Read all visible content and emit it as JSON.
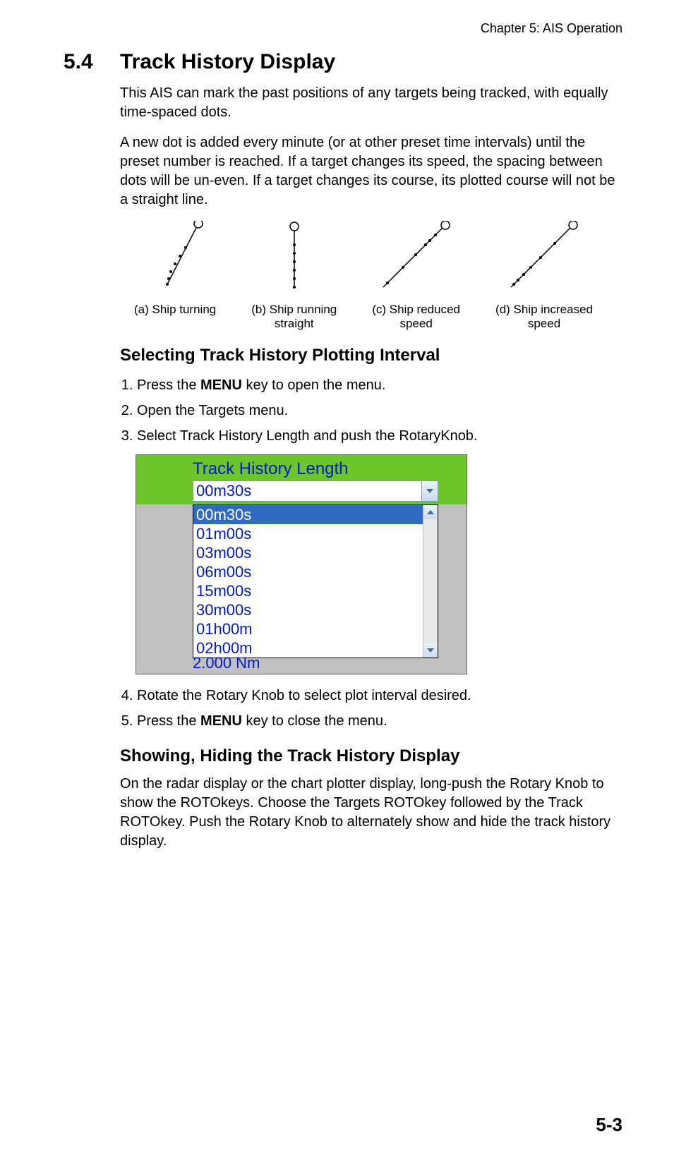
{
  "chapter_header": "Chapter 5: AIS Operation",
  "section": {
    "number": "5.4",
    "title": "Track History Display"
  },
  "paras": {
    "intro1": "This AIS can mark the past positions of any targets being tracked, with equally time-spaced dots.",
    "intro2": "A new dot is added every minute (or at other preset time intervals) until the preset number is reached. If a target changes its speed, the spacing between dots will be un-even. If a target changes its course, its plotted course will not be a straight line."
  },
  "diagrams": {
    "a": {
      "label": "(a) Ship turning"
    },
    "b": {
      "label1": "(b) Ship running",
      "label2": "straight"
    },
    "c": {
      "label1": "(c) Ship reduced",
      "label2": "speed"
    },
    "d": {
      "label1": "(d) Ship increased",
      "label2": "speed"
    }
  },
  "sub1": {
    "heading": "Selecting Track History Plotting Interval",
    "s1a": "Press the ",
    "s1b": "MENU",
    "s1c": " key to open the menu.",
    "s2": "Open the Targets menu.",
    "s3": "Select Track History Length and push the RotaryKnob.",
    "s4": "Rotate the Rotary Knob to select plot interval desired.",
    "s5a": "Press the ",
    "s5b": "MENU",
    "s5c": " key to close the menu."
  },
  "widget": {
    "title": "Track History Length",
    "selected_display": "00m30s",
    "options": [
      "00m30s",
      "01m00s",
      "03m00s",
      "06m00s",
      "15m00s",
      "30m00s",
      "01h00m",
      "02h00m"
    ],
    "ghost": "2.000 Nm"
  },
  "sub2": {
    "heading": "Showing, Hiding the Track History Display",
    "para": "On the radar display or the chart plotter display, long-push the Rotary Knob to show the ROTOkeys. Choose the Targets ROTOkey followed by the Track ROTOkey. Push the Rotary Knob to alternately show and hide the track history display."
  },
  "page_number": "5-3"
}
